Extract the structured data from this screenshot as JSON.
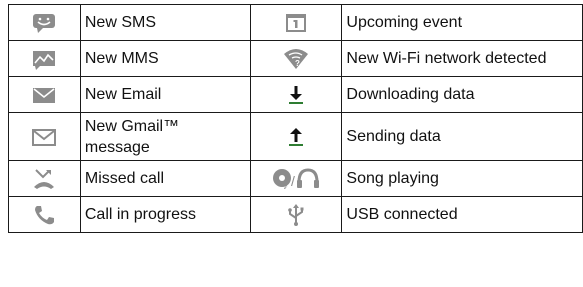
{
  "rows": [
    {
      "left": {
        "icon": "sms-icon",
        "label": "New SMS"
      },
      "right": {
        "icon": "calendar-event-icon",
        "label": "Upcoming event"
      }
    },
    {
      "left": {
        "icon": "mms-icon",
        "label": "New MMS"
      },
      "right": {
        "icon": "wifi-network-icon",
        "label": "New Wi-Fi network detected"
      }
    },
    {
      "left": {
        "icon": "email-icon",
        "label": "New Email"
      },
      "right": {
        "icon": "download-icon",
        "label": "Downloading data"
      }
    },
    {
      "left": {
        "icon": "gmail-icon",
        "label": "New Gmail™ message"
      },
      "right": {
        "icon": "upload-icon",
        "label": "Sending data"
      }
    },
    {
      "left": {
        "icon": "missed-call-icon",
        "label": "Missed call"
      },
      "right": {
        "icon": "song-playing-icon",
        "label": "Song playing"
      }
    },
    {
      "left": {
        "icon": "call-in-progress-icon",
        "label": "Call in progress"
      },
      "right": {
        "icon": "usb-icon",
        "label": "USB connected"
      }
    }
  ],
  "colors": {
    "icon_gray": "#8c8c8c",
    "icon_green": "#2e7d32",
    "border": "#1a1a1a"
  }
}
